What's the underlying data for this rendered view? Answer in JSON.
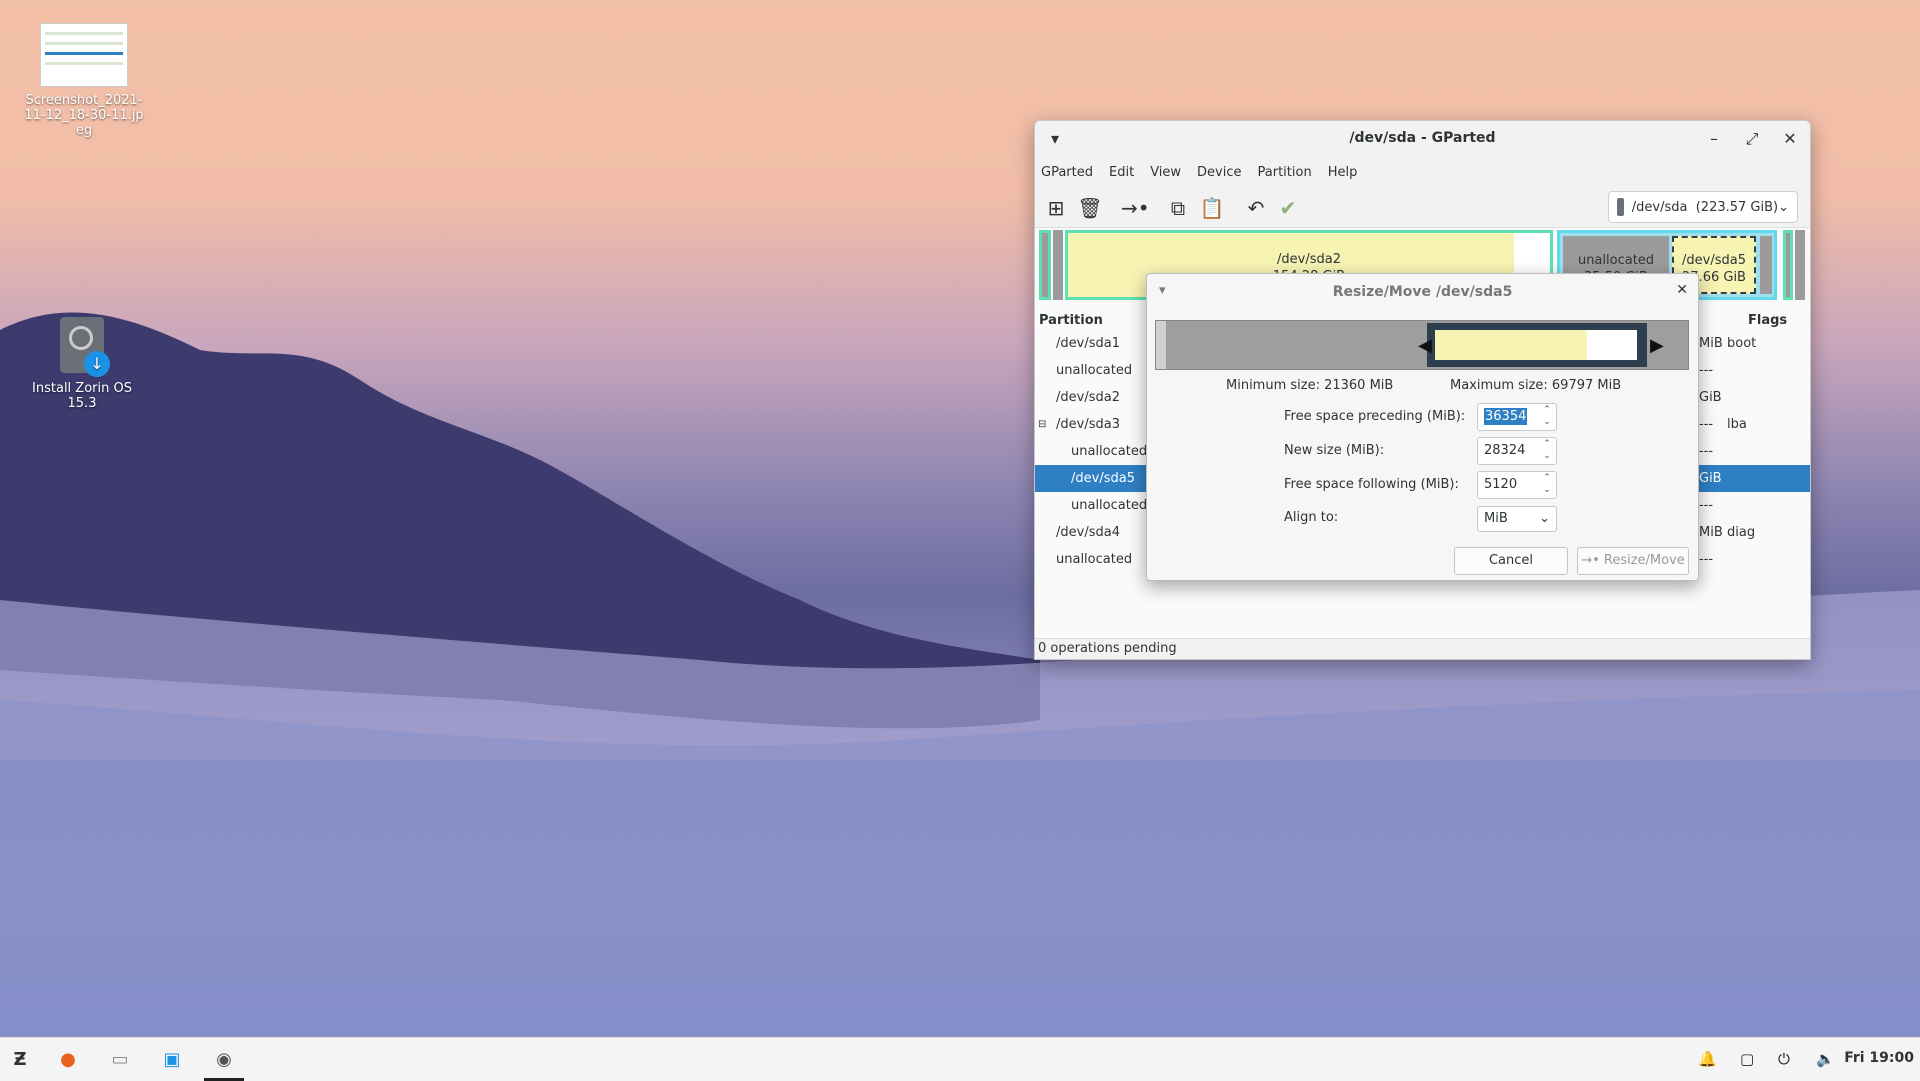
{
  "desktop": {
    "icons": [
      {
        "label": "Screenshot_2021-11-12_18-30-11.jpeg"
      },
      {
        "label": "Install Zorin OS 15.3"
      }
    ]
  },
  "window": {
    "title": "/dev/sda - GParted",
    "menu": [
      "GParted",
      "Edit",
      "View",
      "Device",
      "Partition",
      "Help"
    ],
    "device_selector": "/dev/sda  (223.57 GiB)",
    "disk_map": [
      {
        "name": "/dev/sda2",
        "size": "154.28 GiB"
      },
      {
        "name": "unallocated",
        "size": "35.50 GiB"
      },
      {
        "name": "/dev/sda5",
        "size": "27.66 GiB"
      }
    ],
    "columns": {
      "partition": "Partition",
      "flags": "Flags"
    },
    "rows": [
      {
        "name": "/dev/sda1",
        "size_tail": "MiB",
        "flags": "boot"
      },
      {
        "name": "unallocated",
        "size_tail": "",
        "flags": "---"
      },
      {
        "name": "/dev/sda2",
        "size_tail": "GiB",
        "flags": ""
      },
      {
        "name": "/dev/sda3",
        "size_tail": "---",
        "flags": "lba"
      },
      {
        "name": "unallocated",
        "size_tail": "",
        "flags": "---"
      },
      {
        "name": "/dev/sda5",
        "size_tail": "GiB",
        "flags": ""
      },
      {
        "name": "unallocated",
        "size_tail": "",
        "flags": "---"
      },
      {
        "name": "/dev/sda4",
        "size_tail": "MiB",
        "flags": "diag"
      },
      {
        "name": "unallocated",
        "size_tail": "",
        "flags": "---"
      }
    ],
    "status": "0 operations pending"
  },
  "dialog": {
    "title": "Resize/Move /dev/sda5",
    "min_size": "Minimum size: 21360 MiB",
    "max_size": "Maximum size: 69797 MiB",
    "fields": {
      "preceding": {
        "label": "Free space preceding (MiB):",
        "value": "36354"
      },
      "new_size": {
        "label": "New size (MiB):",
        "value": "28324"
      },
      "following": {
        "label": "Free space following (MiB):",
        "value": "5120"
      },
      "align": {
        "label": "Align to:",
        "value": "MiB"
      }
    },
    "cancel": "Cancel",
    "resize": "Resize/Move"
  },
  "taskbar": {
    "clock": "Fri 19:00"
  }
}
